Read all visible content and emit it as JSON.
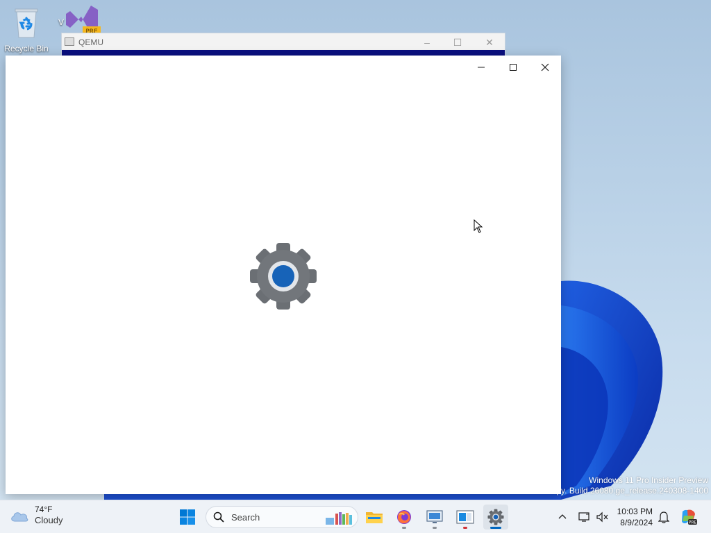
{
  "desktop": {
    "icons": [
      {
        "label": "Recycle Bin",
        "icon": "recycle-bin-icon"
      },
      {
        "label": "V",
        "icon": "visual-studio-preview-icon",
        "badge": "PRE"
      }
    ],
    "watermark": {
      "line1": "Windows 11 Pro Insider Preview",
      "line2": "opy. Build 26080.ge_release.240308-1400"
    }
  },
  "qemu_window": {
    "title": "QEMU",
    "controls": {
      "minimize": "–",
      "maximize": "☐",
      "close": "✕"
    }
  },
  "settings_window": {
    "icon": "settings-gear-icon",
    "colors": {
      "gear": "#6b6f74",
      "center": "#1763b8"
    }
  },
  "taskbar": {
    "weather": {
      "temp": "74°F",
      "condition": "Cloudy",
      "icon": "cloud-icon"
    },
    "search_placeholder": "Search",
    "apps": [
      {
        "name": "start",
        "icon": "windows-start-icon"
      },
      {
        "name": "search",
        "icon": "search-icon"
      },
      {
        "name": "file-explorer",
        "icon": "folder-icon"
      },
      {
        "name": "firefox",
        "icon": "firefox-icon"
      },
      {
        "name": "remote-desktop",
        "icon": "monitor-icon"
      },
      {
        "name": "app",
        "icon": "window-app-icon"
      },
      {
        "name": "settings",
        "icon": "gear-icon",
        "active": true
      }
    ],
    "clock": {
      "time": "10:03 PM",
      "date": "8/9/2024"
    },
    "tray_icons": [
      "chevron-up-icon",
      "network-icon",
      "volume-mute-icon",
      "notification-bell-icon",
      "copilot-icon"
    ],
    "accent": "#0067c0"
  }
}
